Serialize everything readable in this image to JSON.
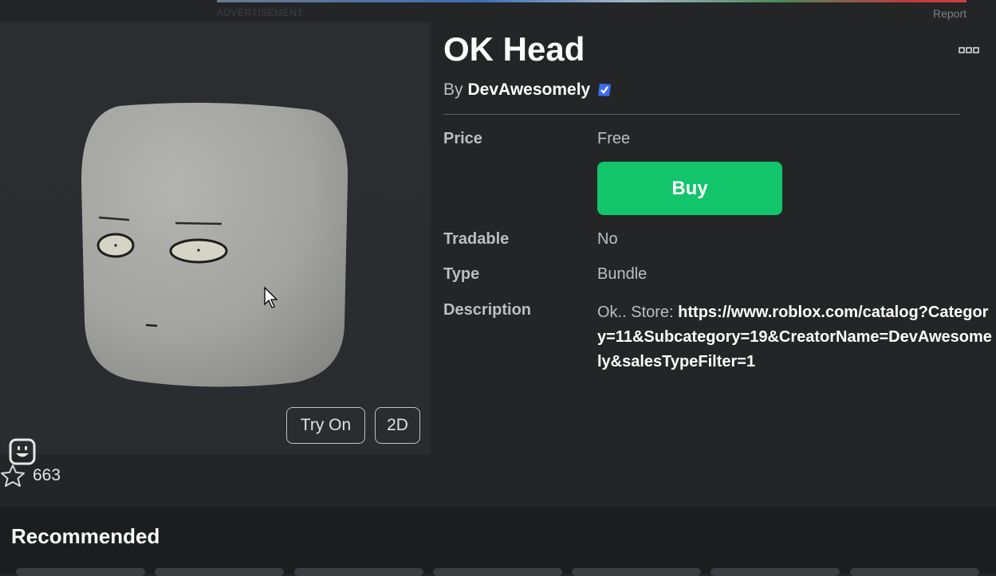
{
  "header": {
    "ad_label": "ADVERTISEMENT",
    "report_label": "Report"
  },
  "viewer": {
    "try_on_label": "Try On",
    "two_d_label": "2D",
    "emote_icon": "smiley-face-icon"
  },
  "favorites": {
    "icon": "star-icon",
    "count": "663"
  },
  "item": {
    "title": "OK Head",
    "by_prefix": "By",
    "creator": "DevAwesomely",
    "verified_icon": "verified-badge-icon",
    "more_icon": "ellipsis-icon"
  },
  "details": {
    "price_label": "Price",
    "price_value": "Free",
    "buy_label": "Buy",
    "tradable_label": "Tradable",
    "tradable_value": "No",
    "type_label": "Type",
    "type_value": "Bundle",
    "description_label": "Description",
    "description_prefix": "Ok.. Store: ",
    "description_link": "https://www.roblox.com/catalog?Category=11&Subcategory=19&CreatorName=DevAwesomely&salesTypeFilter=1"
  },
  "recommended": {
    "title": "Recommended"
  },
  "colors": {
    "buy_green": "#12c46a",
    "background": "#232527",
    "verified_blue": "#3c6ef0"
  }
}
